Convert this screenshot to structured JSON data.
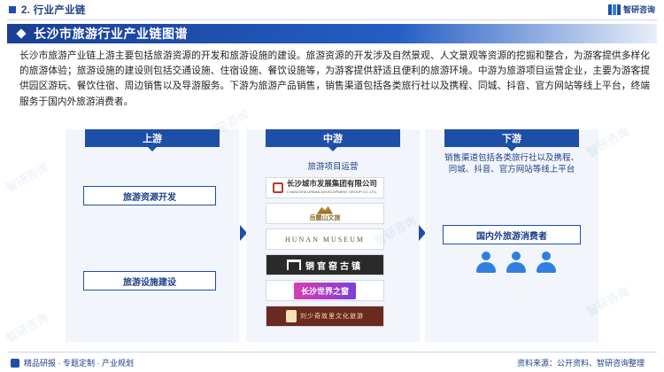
{
  "header": {
    "section_title": "2. 行业产业链",
    "brand_name": "智研咨询"
  },
  "banner": {
    "title": "长沙市旅游行业产业链图谱"
  },
  "intro": "长沙市旅游产业链上游主要包括旅游资源的开发和旅游设施的建设。旅游资源的开发涉及自然景观、人文景观等资源的挖掘和整合，为游客提供多样化的旅游体验；旅游设施的建设则包括交通设施、住宿设施、餐饮设施等，为游客提供舒适且便利的旅游环境。中游为旅游项目运营企业，主要为游客提供园区游玩、餐饮住宿、周边销售以及导游服务。下游为旅游产品销售，销售渠道包括各类旅行社以及携程、同城、抖音、官方网站等线上平台，终端服务于国内外旅游消费者。",
  "upstream": {
    "label": "上游",
    "items": [
      "旅游资源开发",
      "旅游设施建设"
    ]
  },
  "midstream": {
    "label": "中游",
    "sub_label": "旅游项目运营",
    "brands": {
      "changsha_urban_cn": "长沙城市发展集团有限公司",
      "changsha_urban_en": "CHANGSHA URBAN DEVELOPMENT GROUP CO.,LTD.",
      "yuelu": "岳麓山文旅",
      "hunan_museum": "HUNAN MUSEUM",
      "tonggnan": "铜官窑古镇",
      "world_park": "长沙世界之窗",
      "theatre": "刘少奇故里文化旅游"
    }
  },
  "downstream": {
    "label": "下游",
    "desc": "销售渠道包括各类旅行社以及携程、同城、抖音、官方网站等线上平台",
    "consumer": "国内外旅游消费者"
  },
  "footer": {
    "left": "精品研报 · 专题定制 · 产业规划",
    "right": "资料来源：公开资料、智研咨询整理"
  },
  "watermark": "智研咨询"
}
